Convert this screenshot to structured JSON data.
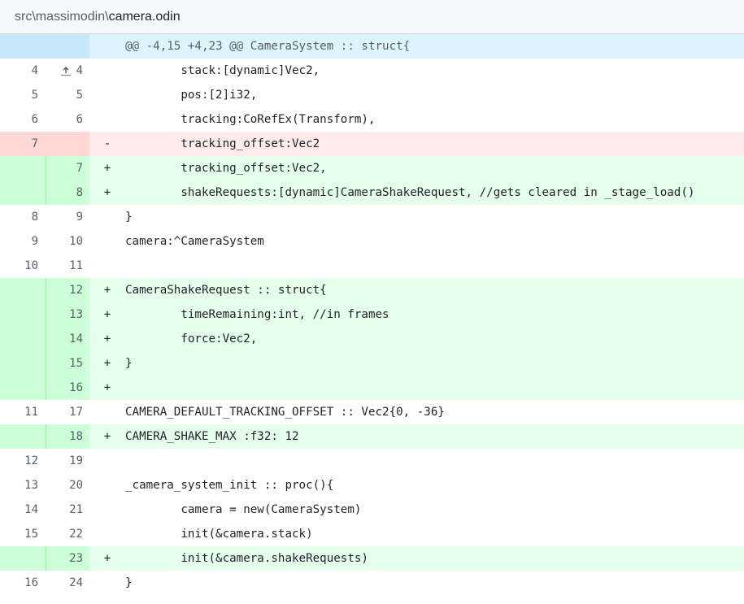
{
  "file": {
    "dir": "src\\massimodin\\",
    "name": "camera.odin"
  },
  "hunk": {
    "header": "@@ -4,15 +4,23 @@ CameraSystem :: struct{"
  },
  "rows": [
    {
      "type": "ctx",
      "old": "4",
      "new": "4",
      "sign": "",
      "code": "        stack:[dynamic]Vec2,"
    },
    {
      "type": "ctx",
      "old": "5",
      "new": "5",
      "sign": "",
      "code": "        pos:[2]i32,"
    },
    {
      "type": "ctx",
      "old": "6",
      "new": "6",
      "sign": "",
      "code": "        tracking:CoRefEx(Transform),"
    },
    {
      "type": "del",
      "old": "7",
      "new": "",
      "sign": "-",
      "code": "        tracking_offset:Vec2"
    },
    {
      "type": "add",
      "old": "",
      "new": "7",
      "sign": "+",
      "code": "        tracking_offset:Vec2,"
    },
    {
      "type": "add",
      "old": "",
      "new": "8",
      "sign": "+",
      "code": "        shakeRequests:[dynamic]CameraShakeRequest, //gets cleared in _stage_load()"
    },
    {
      "type": "ctx",
      "old": "8",
      "new": "9",
      "sign": "",
      "code": "}"
    },
    {
      "type": "ctx",
      "old": "9",
      "new": "10",
      "sign": "",
      "code": "camera:^CameraSystem"
    },
    {
      "type": "ctx",
      "old": "10",
      "new": "11",
      "sign": "",
      "code": ""
    },
    {
      "type": "add",
      "old": "",
      "new": "12",
      "sign": "+",
      "code": "CameraShakeRequest :: struct{"
    },
    {
      "type": "add",
      "old": "",
      "new": "13",
      "sign": "+",
      "code": "        timeRemaining:int, //in frames"
    },
    {
      "type": "add",
      "old": "",
      "new": "14",
      "sign": "+",
      "code": "        force:Vec2,"
    },
    {
      "type": "add",
      "old": "",
      "new": "15",
      "sign": "+",
      "code": "}"
    },
    {
      "type": "add",
      "old": "",
      "new": "16",
      "sign": "+",
      "code": ""
    },
    {
      "type": "ctx",
      "old": "11",
      "new": "17",
      "sign": "",
      "code": "CAMERA_DEFAULT_TRACKING_OFFSET :: Vec2{0, -36}"
    },
    {
      "type": "add",
      "old": "",
      "new": "18",
      "sign": "+",
      "code": "CAMERA_SHAKE_MAX :f32: 12"
    },
    {
      "type": "ctx",
      "old": "12",
      "new": "19",
      "sign": "",
      "code": ""
    },
    {
      "type": "ctx",
      "old": "13",
      "new": "20",
      "sign": "",
      "code": "_camera_system_init :: proc(){"
    },
    {
      "type": "ctx",
      "old": "14",
      "new": "21",
      "sign": "",
      "code": "        camera = new(CameraSystem)"
    },
    {
      "type": "ctx",
      "old": "15",
      "new": "22",
      "sign": "",
      "code": "        init(&camera.stack)"
    },
    {
      "type": "add",
      "old": "",
      "new": "23",
      "sign": "+",
      "code": "        init(&camera.shakeRequests)"
    },
    {
      "type": "ctx",
      "old": "16",
      "new": "24",
      "sign": "",
      "code": "}"
    }
  ],
  "icons": {
    "expand": "expand-up-icon"
  },
  "colors": {
    "add_bg": "#e6ffec",
    "add_num_bg": "#ccffd8",
    "del_bg": "#ffebe9",
    "del_num_bg": "#ffd7d5",
    "hunk_bg": "#ddf4ff",
    "hunk_expand_bg": "#c7e7fb"
  }
}
